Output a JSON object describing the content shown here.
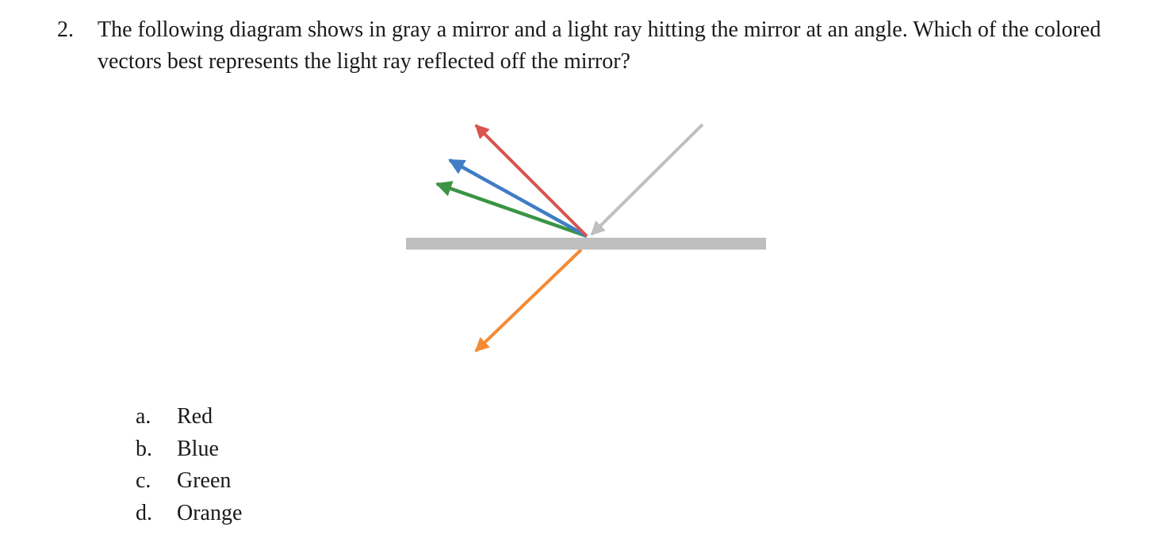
{
  "question": {
    "number": "2.",
    "text": "The following diagram shows in gray a mirror and a light ray hitting the mirror at an angle. Which of the colored vectors best represents the light ray reflected off the mirror?"
  },
  "diagram": {
    "colors": {
      "mirror": "#bfbfbf",
      "incident": "#bfbfbf",
      "red": "#d9534f",
      "blue": "#3f7dc4",
      "green": "#3a9444",
      "orange": "#f58a33"
    }
  },
  "choices": [
    {
      "letter": "a.",
      "label": "Red"
    },
    {
      "letter": "b.",
      "label": "Blue"
    },
    {
      "letter": "c.",
      "label": "Green"
    },
    {
      "letter": "d.",
      "label": "Orange"
    }
  ]
}
